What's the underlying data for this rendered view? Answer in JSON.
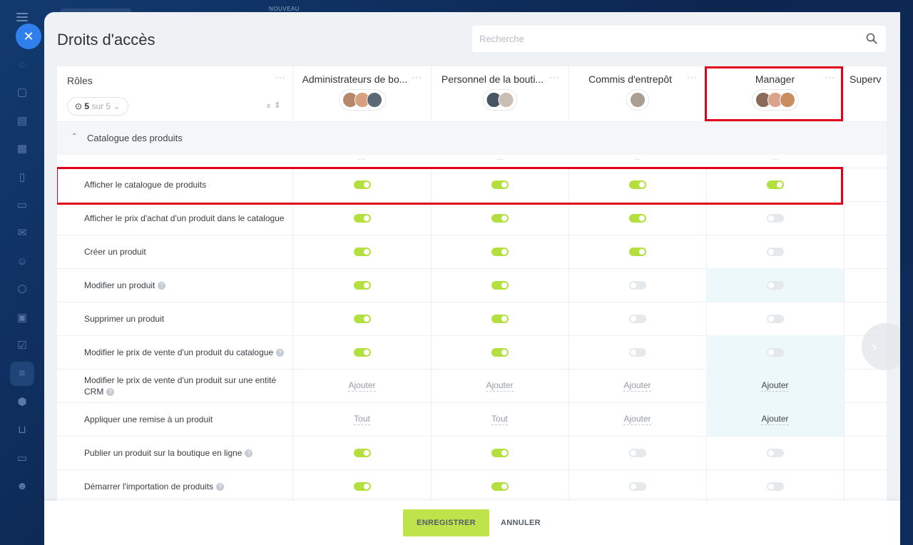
{
  "background": {
    "badge": "NOUVEAU"
  },
  "panel": {
    "title": "Droits d'accès"
  },
  "search": {
    "placeholder": "Recherche"
  },
  "roles_header": {
    "title": "Rôles",
    "filter_current": "5",
    "filter_rest": "sur 5"
  },
  "columns": [
    {
      "name": "Administrateurs de bo...",
      "avatar_colors": [
        "#b8876a",
        "#d7a07e",
        "#5b6876"
      ]
    },
    {
      "name": "Personnel de la bouti...",
      "avatar_colors": [
        "#4a5563",
        "#c9bfb4"
      ]
    },
    {
      "name": "Commis d'entrepôt",
      "avatar_colors": [
        "#a99f93"
      ]
    },
    {
      "name": "Manager",
      "avatar_colors": [
        "#8a6a58",
        "#d9a48a",
        "#c98d5e"
      ]
    },
    {
      "name": "Superv"
    }
  ],
  "section": {
    "title": "Catalogue des produits"
  },
  "rows": [
    {
      "label": "Afficher le catalogue de produits",
      "help": false,
      "values": [
        "on",
        "on",
        "on",
        "on"
      ]
    },
    {
      "label": "Afficher le prix d'achat d'un produit dans le catalogue",
      "help": false,
      "values": [
        "on",
        "on",
        "on",
        "off"
      ]
    },
    {
      "label": "Créer un produit",
      "help": false,
      "values": [
        "on",
        "on",
        "on",
        "off"
      ]
    },
    {
      "label": "Modifier un produit",
      "help": true,
      "values": [
        "on",
        "on",
        "off",
        "off"
      ]
    },
    {
      "label": "Supprimer un produit",
      "help": false,
      "values": [
        "on",
        "on",
        "off",
        "off"
      ]
    },
    {
      "label": "Modifier le prix de vente d'un produit du catalogue",
      "help": true,
      "values": [
        "on",
        "on",
        "off",
        "off"
      ]
    },
    {
      "label": "Modifier le prix de vente d'un produit sur une entité CRM",
      "help": true,
      "values": [
        "Ajouter",
        "Ajouter",
        "Ajouter",
        "Ajouter"
      ]
    },
    {
      "label": "Appliquer une remise à un produit",
      "help": false,
      "values": [
        "Tout",
        "Tout",
        "Ajouter",
        "Ajouter"
      ]
    },
    {
      "label": "Publier un produit sur la boutique en ligne",
      "help": true,
      "values": [
        "on",
        "on",
        "off",
        "off"
      ]
    },
    {
      "label": "Démarrer l'importation de produits",
      "help": true,
      "values": [
        "on",
        "on",
        "off",
        "off"
      ]
    }
  ],
  "highlighted_cells": [
    [
      3,
      3
    ],
    [
      5,
      3
    ],
    [
      6,
      3
    ],
    [
      7,
      3
    ]
  ],
  "footer": {
    "save": "ENREGISTRER",
    "cancel": "ANNULER"
  },
  "colors": {
    "toggle_on": "#b3e03f",
    "save_button": "#bfe34a",
    "highlight_box": "#e0001b",
    "close_button": "#2f80ed"
  }
}
